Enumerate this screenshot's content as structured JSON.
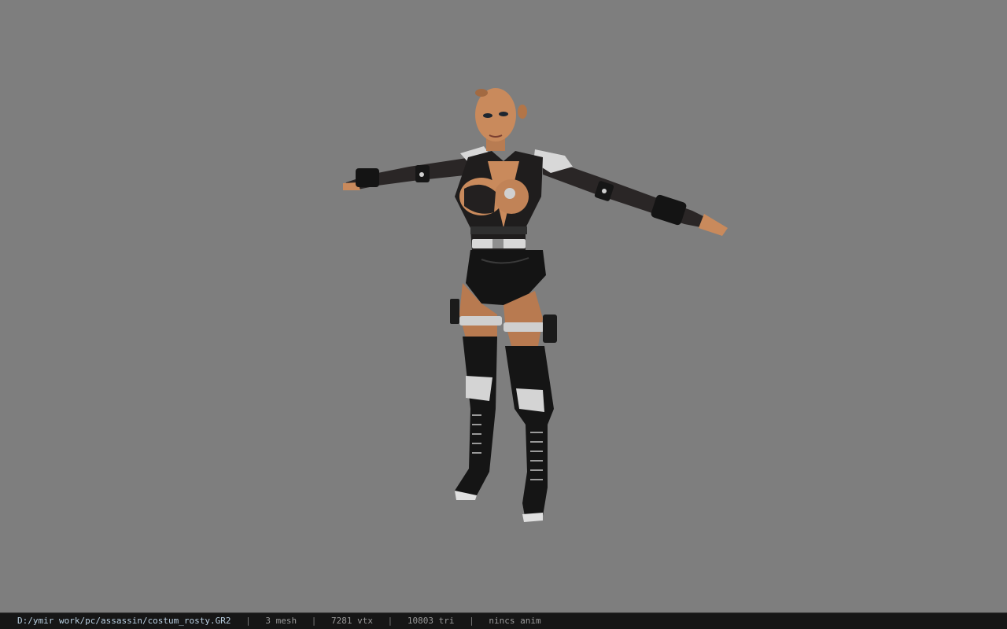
{
  "viewer": {
    "model_name": "3D character model",
    "background_color": "#7e7e7e"
  },
  "statusbar": {
    "file_path": "D:/ymir work/pc/assassin/costum_rosty.GR2",
    "separator": "|",
    "mesh_count": "3 mesh",
    "vertex_count": "7281 vtx",
    "triangle_count": "10803 tri",
    "animation": "nincs anim"
  },
  "colors": {
    "skin": "#c98a5c",
    "outfit": "#1e1e1e",
    "armor_highlight": "#d8d8d8",
    "statusbar_bg": "#161616"
  }
}
